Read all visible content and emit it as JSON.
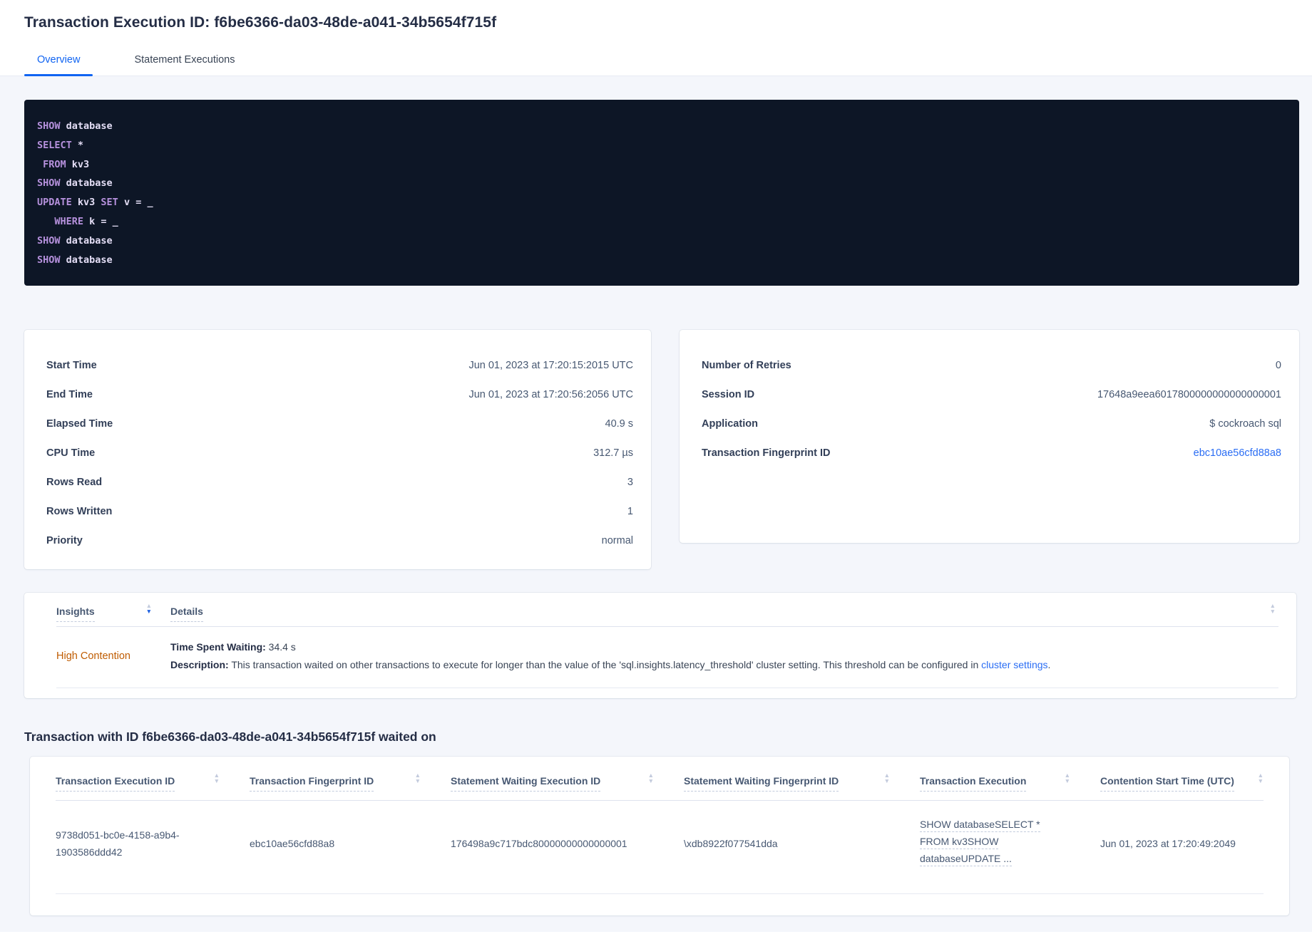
{
  "page": {
    "title": "Transaction Execution ID: f6be6366-da03-48de-a041-34b5654f715f",
    "tabs": {
      "overview": "Overview",
      "statement_executions": "Statement Executions"
    }
  },
  "colors": {
    "accent_blue": "#1064f2",
    "link_blue": "#2a6df4",
    "insight_orange": "#bf5b00",
    "code_background": "#0d1626",
    "code_keyword": "#b691dd",
    "code_identifier": "#e4def6",
    "content_background": "#f4f6fb"
  },
  "icons": {
    "sort_up": "▲",
    "sort_down": "▼"
  },
  "sql": {
    "lines": [
      [
        {
          "t": "kw",
          "v": "SHOW"
        },
        {
          "t": "id",
          "v": " database"
        }
      ],
      [
        {
          "t": "kw",
          "v": "SELECT"
        },
        {
          "t": "id",
          "v": " *"
        }
      ],
      [
        {
          "t": "id",
          "v": " "
        },
        {
          "t": "kw",
          "v": "FROM"
        },
        {
          "t": "id",
          "v": " kv3"
        }
      ],
      [
        {
          "t": "kw",
          "v": "SHOW"
        },
        {
          "t": "id",
          "v": " database"
        }
      ],
      [
        {
          "t": "kw",
          "v": "UPDATE"
        },
        {
          "t": "id",
          "v": " kv3 "
        },
        {
          "t": "kw",
          "v": "SET"
        },
        {
          "t": "id",
          "v": " v = _"
        }
      ],
      [
        {
          "t": "id",
          "v": "   "
        },
        {
          "t": "kw",
          "v": "WHERE"
        },
        {
          "t": "id",
          "v": " k = _"
        }
      ],
      [
        {
          "t": "kw",
          "v": "SHOW"
        },
        {
          "t": "id",
          "v": " database"
        }
      ],
      [
        {
          "t": "kw",
          "v": "SHOW"
        },
        {
          "t": "id",
          "v": " database"
        }
      ]
    ]
  },
  "left_card": {
    "rows": [
      {
        "label": "Start Time",
        "value": "Jun 01, 2023 at 17:20:15:2015 UTC"
      },
      {
        "label": "End Time",
        "value": "Jun 01, 2023 at 17:20:56:2056 UTC"
      },
      {
        "label": "Elapsed Time",
        "value": "40.9 s"
      },
      {
        "label": "CPU Time",
        "value": "312.7 µs"
      },
      {
        "label": "Rows Read",
        "value": "3"
      },
      {
        "label": "Rows Written",
        "value": "1"
      },
      {
        "label": "Priority",
        "value": "normal"
      }
    ]
  },
  "right_card": {
    "rows": [
      {
        "label": "Number of Retries",
        "value": "0"
      },
      {
        "label": "Session ID",
        "value": "17648a9eea6017800000000000000001"
      },
      {
        "label": "Application",
        "value": "$ cockroach sql"
      }
    ],
    "fingerprint": {
      "label": "Transaction Fingerprint ID",
      "value": "ebc10ae56cfd88a8"
    }
  },
  "insights": {
    "headers": {
      "insights": "Insights",
      "details": "Details"
    },
    "row": {
      "insight": "High Contention",
      "waiting_label": "Time Spent Waiting:",
      "waiting_value": " 34.4 s",
      "description_label": "Description:",
      "description_text": " This transaction waited on other transactions to execute for longer than the value of the 'sql.insights.latency_threshold' cluster setting. This threshold can be configured in ",
      "description_link": "cluster settings",
      "description_suffix": "."
    }
  },
  "waited_on": {
    "heading": "Transaction with ID f6be6366-da03-48de-a041-34b5654f715f waited on",
    "columns": {
      "c1": "Transaction Execution ID",
      "c2": "Transaction Fingerprint ID",
      "c3": "Statement Waiting Execution ID",
      "c4": "Statement Waiting Fingerprint ID",
      "c5": "Transaction Execution",
      "c6": "Contention Start Time (UTC)"
    },
    "row": {
      "txn_execution_id": "9738d051-bc0e-4158-a9b4-1903586ddd42",
      "txn_fingerprint_id": "ebc10ae56cfd88a8",
      "stmt_waiting_execution_id": "176498a9c717bdc80000000000000001",
      "stmt_waiting_fingerprint_id": "\\xdb8922f077541dda",
      "txn_execution_lines": [
        "SHOW databaseSELECT *",
        "FROM kv3SHOW",
        "databaseUPDATE ..."
      ],
      "contention_start": "Jun 01, 2023 at 17:20:49:2049"
    }
  }
}
